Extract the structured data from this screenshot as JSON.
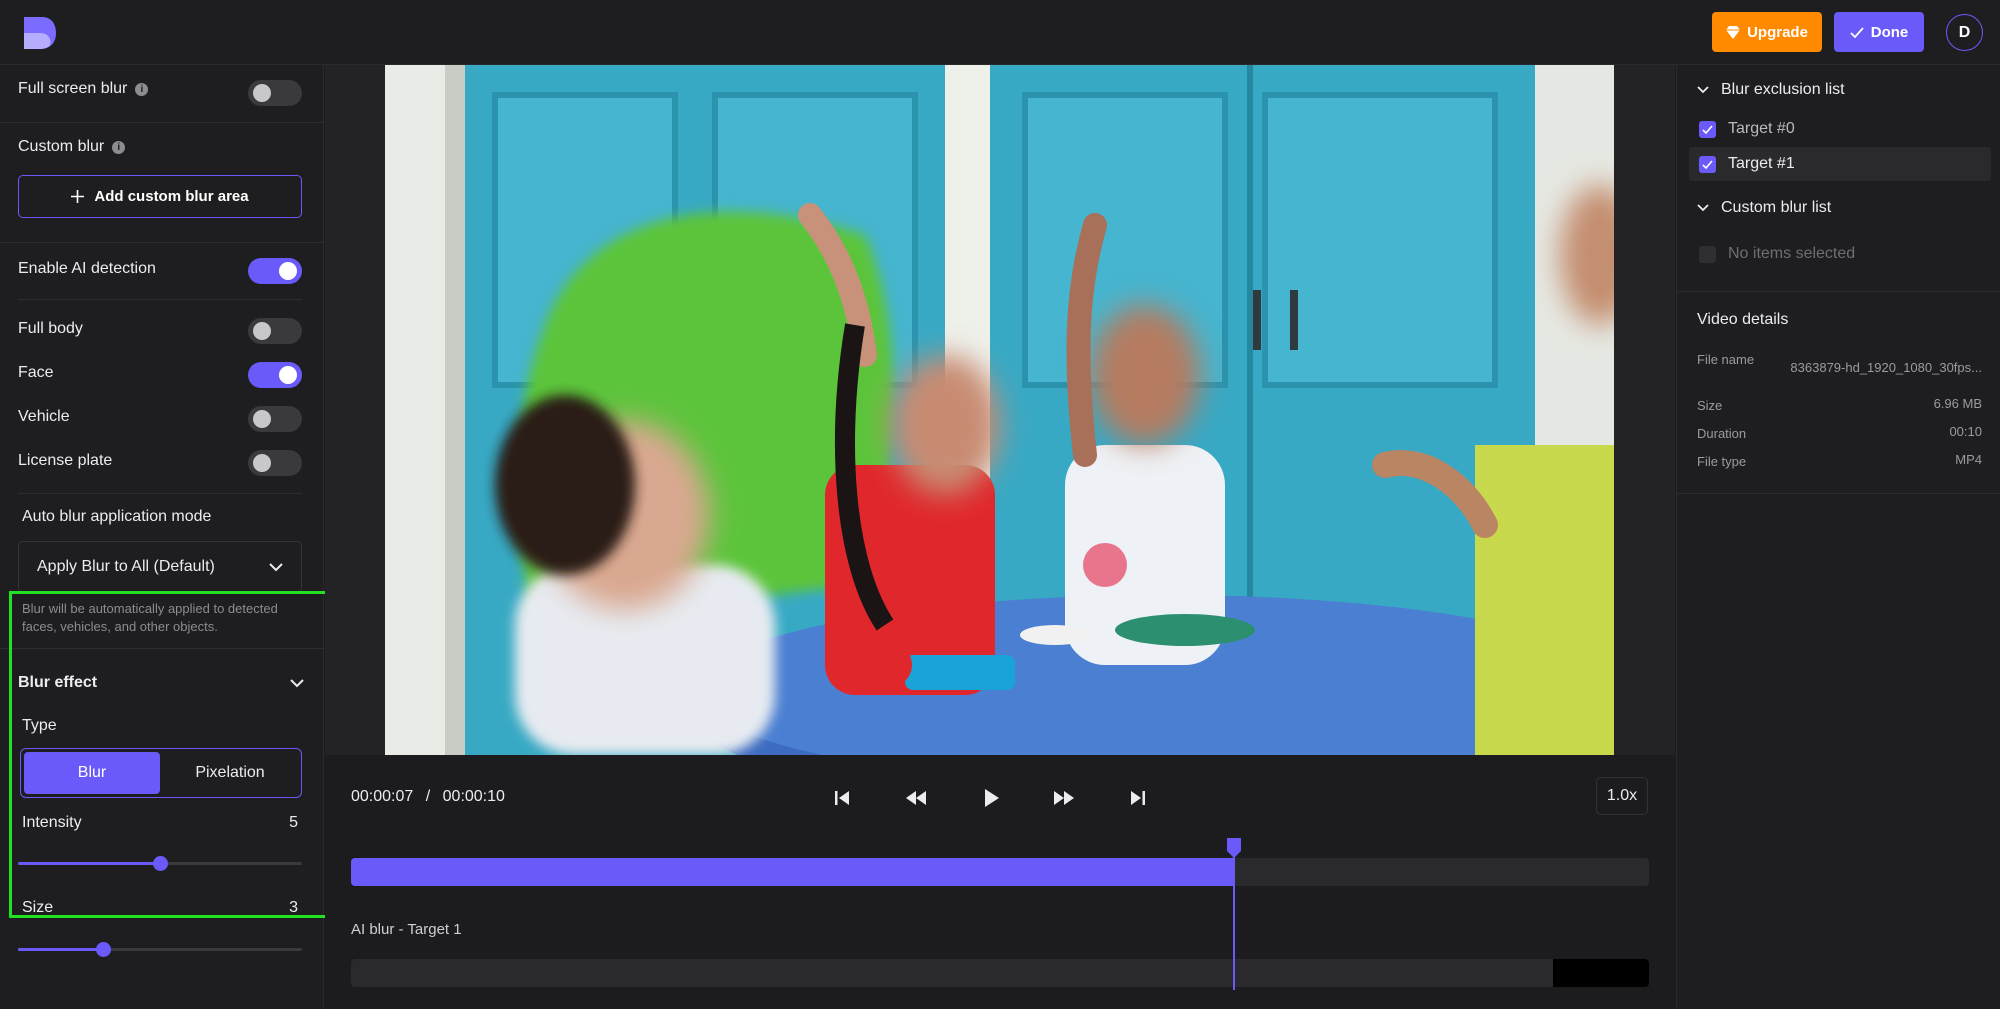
{
  "header": {
    "upgrade_label": "Upgrade",
    "done_label": "Done",
    "avatar_initial": "D"
  },
  "left_panel": {
    "full_screen_blur_label": "Full screen blur",
    "full_screen_blur_on": false,
    "custom_blur_label": "Custom blur",
    "add_custom_blur_label": "Add custom blur area",
    "enable_ai_label": "Enable AI detection",
    "enable_ai_on": true,
    "detections": [
      {
        "label": "Full body",
        "on": false
      },
      {
        "label": "Face",
        "on": true
      },
      {
        "label": "Vehicle",
        "on": false
      },
      {
        "label": "License plate",
        "on": false
      }
    ],
    "auto_mode_label": "Auto blur application mode",
    "auto_mode_value": "Apply Blur to All (Default)",
    "auto_mode_help": "Blur will be automatically applied to detected faces, vehicles, and other objects.",
    "blur_effect": {
      "title": "Blur effect",
      "type_label": "Type",
      "type_options": [
        "Blur",
        "Pixelation"
      ],
      "type_selected": "Blur",
      "intensity_label": "Intensity",
      "intensity_value": "5",
      "intensity_fraction": 0.5,
      "size_label": "Size",
      "size_value": "3",
      "size_fraction": 0.3
    }
  },
  "player": {
    "current_time": "00:00:07",
    "separator": "/",
    "total_time": "00:00:10",
    "speed": "1.0x",
    "progress_fraction": 0.68,
    "layer_label": "AI blur - Target 1"
  },
  "right_panel": {
    "exclusion_title": "Blur exclusion list",
    "exclusion_items": [
      {
        "label": "Target #0",
        "checked": true
      },
      {
        "label": "Target #1",
        "checked": true
      }
    ],
    "custom_title": "Custom blur list",
    "custom_empty": "No items selected",
    "details_title": "Video details",
    "details": {
      "file_name_label": "File name",
      "file_name_value": "8363879-hd_1920_1080_30fps...",
      "size_label": "Size",
      "size_value": "6.96 MB",
      "duration_label": "Duration",
      "duration_value": "00:10",
      "file_type_label": "File type",
      "file_type_value": "MP4"
    }
  },
  "colors": {
    "accent": "#6a5af9",
    "upgrade": "#ff8a00",
    "highlight": "#22e022",
    "background": "#1e1e20"
  },
  "icons": [
    "logo-icon",
    "gem-icon",
    "check-icon",
    "info-icon",
    "plus-icon",
    "chevron-down-icon",
    "skip-start-icon",
    "rewind-icon",
    "play-icon",
    "fast-forward-icon",
    "skip-end-icon"
  ]
}
